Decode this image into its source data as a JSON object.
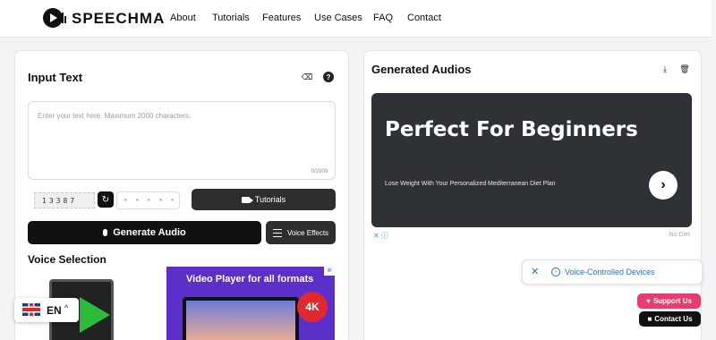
{
  "brand": {
    "name": "SPEECHMA"
  },
  "nav": {
    "items": [
      "About",
      "Tutorials",
      "Features",
      "Use Cases",
      "FAQ",
      "Contact"
    ]
  },
  "input_panel": {
    "title": "Input Text",
    "placeholder": "Enter your text here. Maximum 2000 characters.",
    "char_count": "0/2000",
    "captcha_code": "13387",
    "code_placeholder": "• • • • •",
    "tutorials_label": "Tutorials",
    "generate_label": "Generate Audio",
    "voice_effects_label": "Voice Effects",
    "voice_selection_title": "Voice Selection"
  },
  "left_ad": {
    "headline": "Video Player for all formats",
    "badge": "4K"
  },
  "output_panel": {
    "title": "Generated Audios",
    "ad": {
      "headline": "Perfect For Beginners",
      "subtext": "Lose Weight With Your Personalized Mediterranean Diet Plan",
      "advertiser": "No Diet"
    }
  },
  "toast": {
    "label": "Voice-Controlled Devices"
  },
  "floating": {
    "support_label": "Support Us",
    "contact_label": "Contact Us"
  },
  "language": {
    "code": "EN"
  },
  "icons": [
    "play-logo-icon",
    "eraser-icon",
    "help-icon",
    "refresh-icon",
    "video-camera-icon",
    "microphone-icon",
    "sliders-icon",
    "download-icon",
    "trash-icon",
    "chevron-right-icon",
    "close-icon",
    "info-icon",
    "heart-icon",
    "chat-icon",
    "uk-flag-icon",
    "chevron-up-icon"
  ],
  "colors": {
    "primary": "#111111",
    "support": "#e83e6f",
    "link": "#2a6fcf",
    "ad_card": "#2e3236"
  }
}
